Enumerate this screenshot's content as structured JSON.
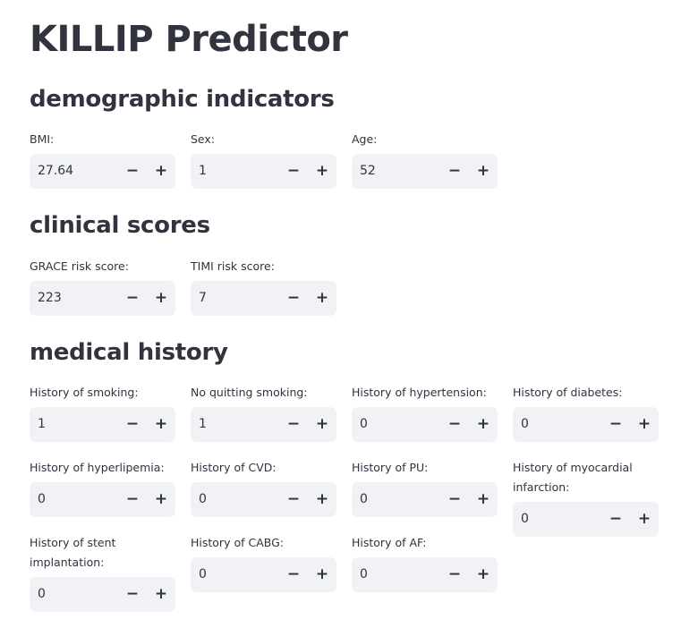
{
  "page": {
    "title": "KILLIP Predictor"
  },
  "controls": {
    "decrement_symbol": "−",
    "increment_symbol": "+"
  },
  "sections": {
    "demographic": {
      "heading": "demographic indicators",
      "fields": [
        {
          "label": "BMI:",
          "value": "27.64"
        },
        {
          "label": "Sex:",
          "value": "1"
        },
        {
          "label": "Age:",
          "value": "52"
        }
      ]
    },
    "clinical": {
      "heading": "clinical scores",
      "fields": [
        {
          "label": "GRACE risk score:",
          "value": "223"
        },
        {
          "label": "TIMI risk score:",
          "value": "7"
        }
      ]
    },
    "history": {
      "heading": "medical history",
      "fields": [
        {
          "label": "History of smoking:",
          "value": "1"
        },
        {
          "label": "No quitting smoking:",
          "value": "1"
        },
        {
          "label": "History of hypertension:",
          "value": "0"
        },
        {
          "label": "History of diabetes:",
          "value": "0"
        },
        {
          "label": "History of hyperlipemia:",
          "value": "0"
        },
        {
          "label": "History of CVD:",
          "value": "0"
        },
        {
          "label": "History of PU:",
          "value": "0"
        },
        {
          "label": "History of myocardial infarction:",
          "value": "0"
        },
        {
          "label": "History of stent implantation:",
          "value": "0"
        },
        {
          "label": "History of CABG:",
          "value": "0"
        },
        {
          "label": "History of AF:",
          "value": "0"
        }
      ]
    }
  }
}
